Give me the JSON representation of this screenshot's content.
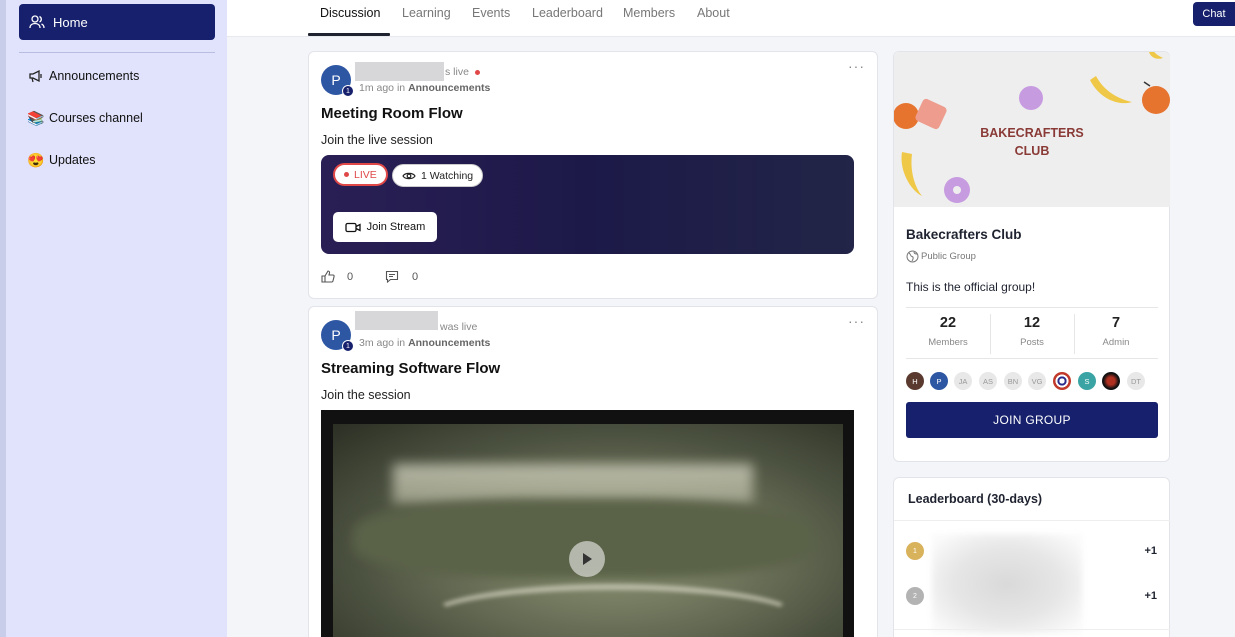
{
  "sidebar": {
    "items": [
      {
        "label": "Home",
        "icon": "users-icon"
      },
      {
        "label": "Announcements",
        "icon": "megaphone-icon"
      },
      {
        "label": "Courses channel",
        "icon": "books-emoji"
      },
      {
        "label": "Updates",
        "icon": "heart-eyes-emoji"
      }
    ]
  },
  "tabs": [
    "Discussion",
    "Learning",
    "Events",
    "Leaderboard",
    "Members",
    "About"
  ],
  "chat_label": "Chat",
  "posts": [
    {
      "avatar": "P",
      "badge": "1",
      "status": "s live",
      "time": "1m ago",
      "in_word": "in",
      "channel": "Announcements",
      "title": "Meeting Room Flow",
      "body": "Join the live session",
      "live_label": "LIVE",
      "watching": "1 Watching",
      "join_label": "Join Stream",
      "likes": "0",
      "comments": "0"
    },
    {
      "avatar": "P",
      "badge": "1",
      "status": "was live",
      "time": "3m ago",
      "in_word": "in",
      "channel": "Announcements",
      "title": "Streaming Software Flow",
      "body": "Join the session"
    }
  ],
  "group": {
    "banner_text_1": "BAKECRAFTERS",
    "banner_text_2": "CLUB",
    "name": "Bakecrafters Club",
    "type": "Public Group",
    "description": "This is the official group!",
    "stats": [
      {
        "value": "22",
        "label": "Members"
      },
      {
        "value": "12",
        "label": "Posts"
      },
      {
        "value": "7",
        "label": "Admin"
      }
    ],
    "member_avatars": [
      "H",
      "P",
      "JA",
      "AS",
      "BN",
      "VG",
      "",
      "S",
      "",
      "DT"
    ],
    "join_label": "JOIN GROUP"
  },
  "leaderboard": {
    "title": "Leaderboard (30-days)",
    "rows": [
      {
        "rank": "1",
        "score": "+1"
      },
      {
        "rank": "2",
        "score": "+1"
      }
    ]
  },
  "colors": {
    "primary": "#16206c",
    "sidebar_bg": "#e1e3fc",
    "live_red": "#e04848"
  }
}
